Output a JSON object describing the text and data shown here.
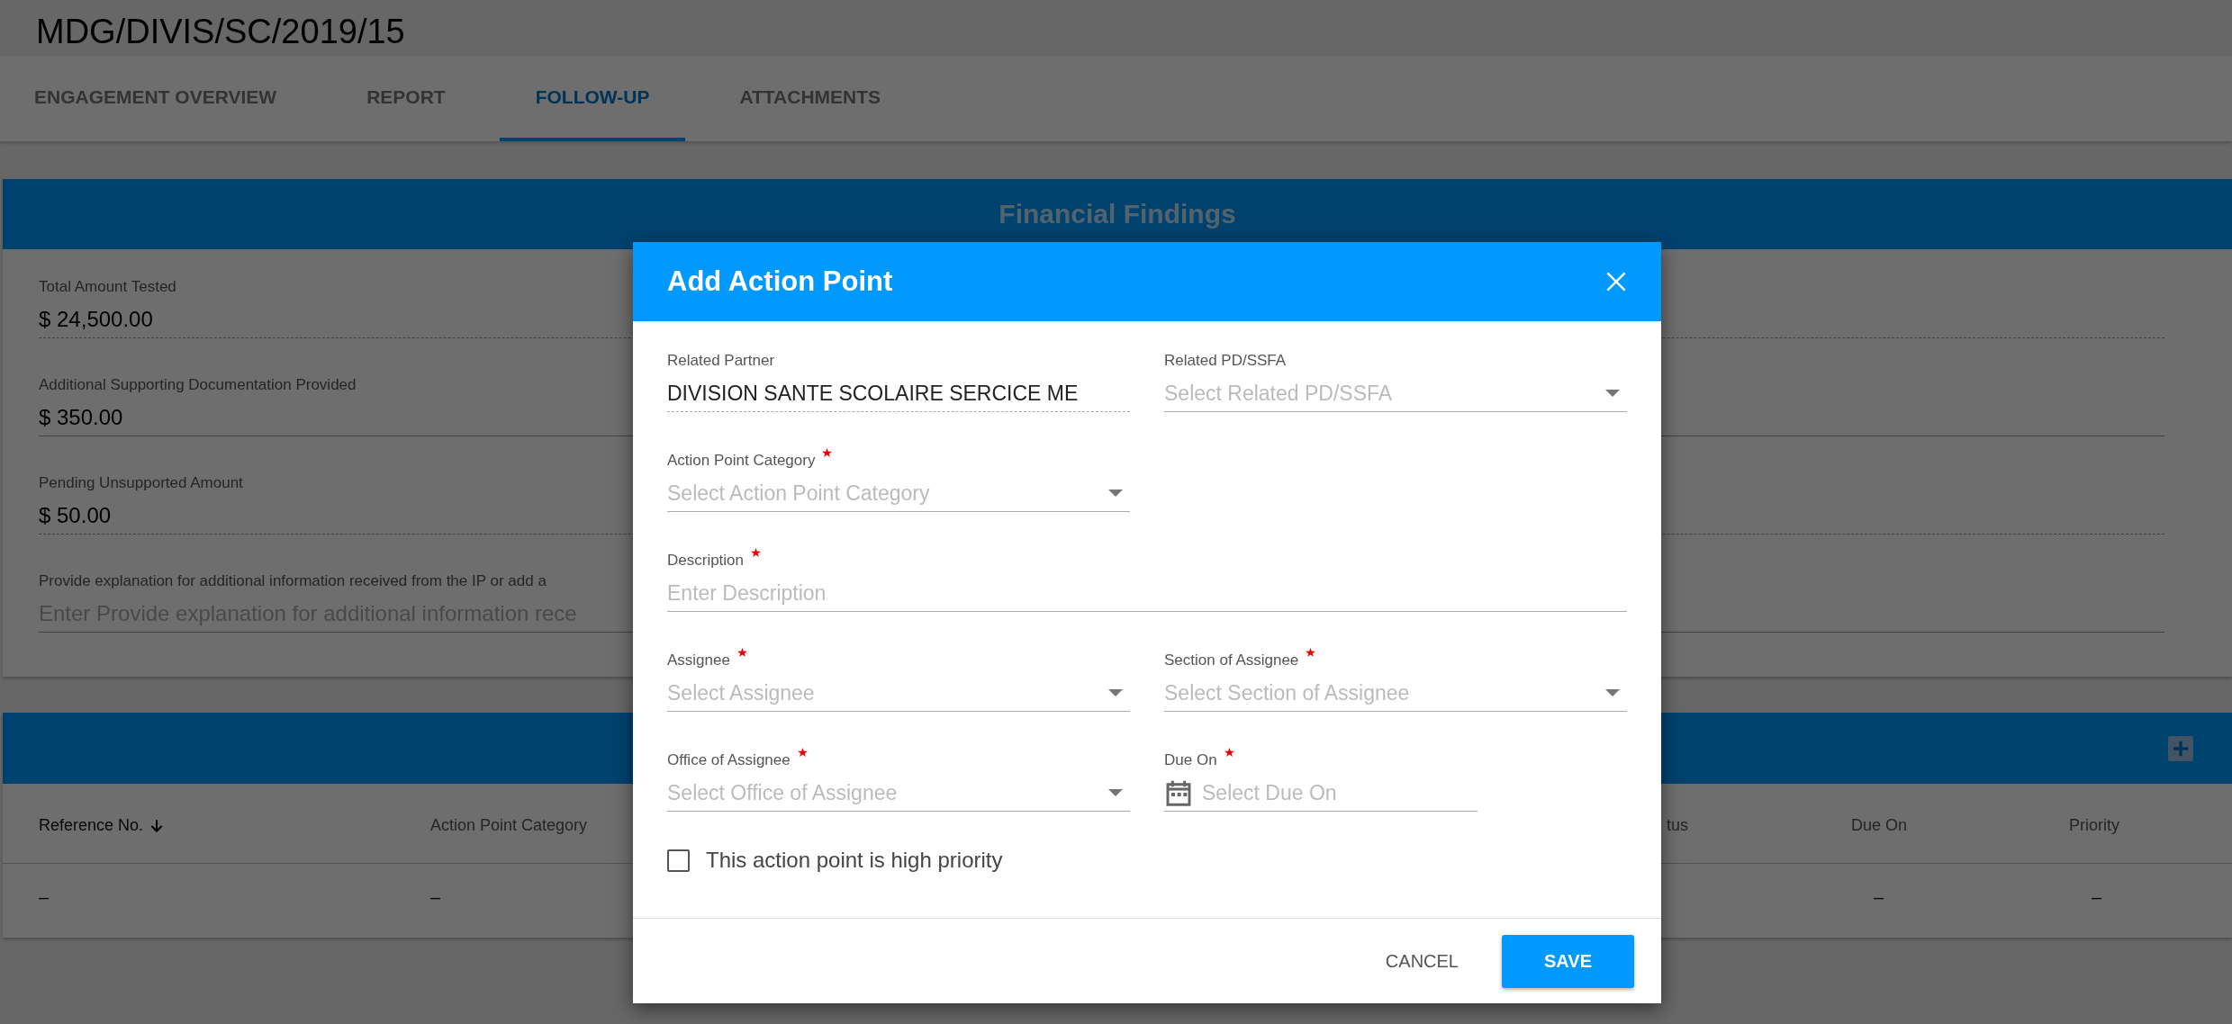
{
  "page": {
    "title": "MDG/DIVIS/SC/2019/15"
  },
  "tabs": [
    {
      "label": "ENGAGEMENT OVERVIEW",
      "selected": false
    },
    {
      "label": "REPORT",
      "selected": false
    },
    {
      "label": "FOLLOW-UP",
      "selected": true
    },
    {
      "label": "ATTACHMENTS",
      "selected": false
    }
  ],
  "financial_findings": {
    "title": "Financial Findings",
    "fields": [
      {
        "label": "Total Amount Tested",
        "value": "$ 24,500.00",
        "readonly": true
      },
      {
        "label": "Additional Supporting Documentation Provided",
        "value": "$ 350.00",
        "readonly": false
      },
      {
        "label": "Pending Unsupported Amount",
        "value": "$ 50.00",
        "readonly": true
      },
      {
        "label": "Provide explanation for additional information received from the IP or add a",
        "placeholder": "Enter Provide explanation for additional information rece",
        "readonly": false
      }
    ]
  },
  "action_points": {
    "columns": [
      {
        "label": "Reference No.",
        "sorted": true
      },
      {
        "label": "Action Point Category",
        "sorted": false
      },
      {
        "label": "tus",
        "sorted": false
      },
      {
        "label": "Due On",
        "sorted": false
      },
      {
        "label": "Priority",
        "sorted": false
      }
    ],
    "rows": [
      {
        "cells": [
          "–",
          "–",
          null,
          "–",
          "–"
        ]
      }
    ]
  },
  "dialog": {
    "title": "Add Action Point",
    "rows": [
      [
        {
          "label": "Related Partner",
          "value": "DIVISION SANTE SCOLAIRE SERCICE ME",
          "required": false,
          "kind": "readonly"
        },
        {
          "label": "Related PD/SSFA",
          "placeholder": "Select Related PD/SSFA",
          "required": false,
          "kind": "select"
        }
      ],
      [
        {
          "label": "Action Point Category",
          "placeholder": "Select Action Point Category",
          "required": true,
          "kind": "select"
        }
      ],
      [
        {
          "label": "Description",
          "placeholder": "Enter Description",
          "required": true,
          "kind": "text"
        }
      ],
      [
        {
          "label": "Assignee",
          "placeholder": "Select Assignee",
          "required": true,
          "kind": "select"
        },
        {
          "label": "Section of Assignee",
          "placeholder": "Select Section of Assignee",
          "required": true,
          "kind": "select"
        }
      ],
      [
        {
          "label": "Office of Assignee",
          "placeholder": "Select Office of Assignee",
          "required": true,
          "kind": "select"
        },
        {
          "label": "Due On",
          "placeholder": "Select Due On",
          "required": true,
          "kind": "date"
        }
      ]
    ],
    "checkbox": {
      "label": "This action point is high priority",
      "checked": false
    },
    "buttons": [
      {
        "label": "CANCEL",
        "kind": "flat"
      },
      {
        "label": "SAVE",
        "kind": "raised"
      }
    ]
  }
}
